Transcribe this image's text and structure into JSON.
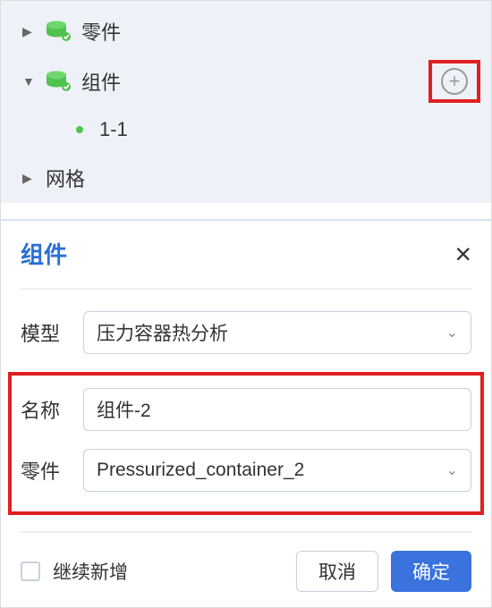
{
  "tree": {
    "item_parts": "零件",
    "item_components": "组件",
    "item_component_child": "1-1",
    "item_mesh": "网格"
  },
  "dialog": {
    "title": "组件",
    "labels": {
      "model": "模型",
      "name": "名称",
      "parts": "零件"
    },
    "values": {
      "model": "压力容器热分析",
      "name": "组件-2",
      "parts": "Pressurized_container_2"
    },
    "continue_add": "继续新增",
    "cancel": "取消",
    "confirm": "确定"
  },
  "icons": {
    "plus": "+",
    "close": "×",
    "caret_right": "▶",
    "caret_down": "▼",
    "chevron_down": "⌄"
  }
}
